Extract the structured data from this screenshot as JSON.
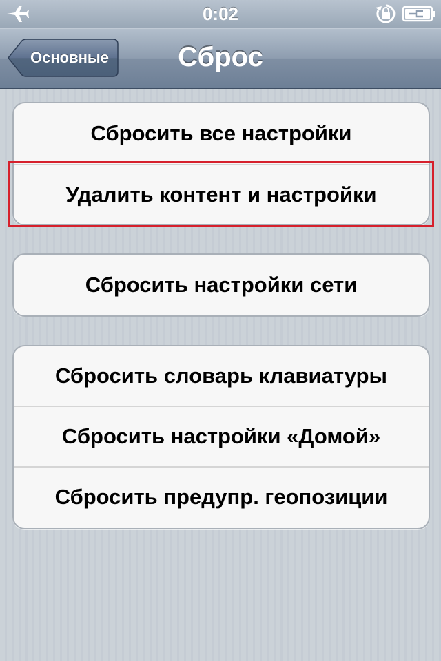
{
  "status_bar": {
    "time": "0:02",
    "icons": [
      "airplane-icon",
      "rotation-lock-icon",
      "battery-charging-icon"
    ]
  },
  "nav": {
    "back_label": "Основные",
    "title": "Сброс"
  },
  "groups": [
    {
      "items": [
        {
          "label": "Сбросить все настройки"
        },
        {
          "label": "Удалить контент и настройки",
          "highlighted": true
        }
      ]
    },
    {
      "items": [
        {
          "label": "Сбросить настройки сети"
        }
      ]
    },
    {
      "items": [
        {
          "label": "Сбросить словарь клавиатуры"
        },
        {
          "label": "Сбросить настройки «Домой»"
        },
        {
          "label": "Сбросить предупр. геопозиции"
        }
      ]
    }
  ],
  "colors": {
    "highlight": "#d6202c",
    "nav_bar": "#6d7f96",
    "background": "#c5ccd4"
  }
}
